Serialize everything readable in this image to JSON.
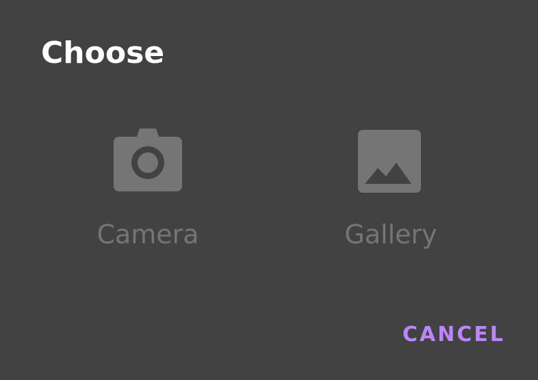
{
  "dialog": {
    "title": "Choose",
    "options": [
      {
        "label": "Camera",
        "icon": "camera-icon"
      },
      {
        "label": "Gallery",
        "icon": "image-icon"
      }
    ],
    "cancel_label": "CANCEL"
  },
  "colors": {
    "background": "#424242",
    "title": "#ffffff",
    "option_muted": "#757575",
    "accent": "#bb86fc"
  }
}
